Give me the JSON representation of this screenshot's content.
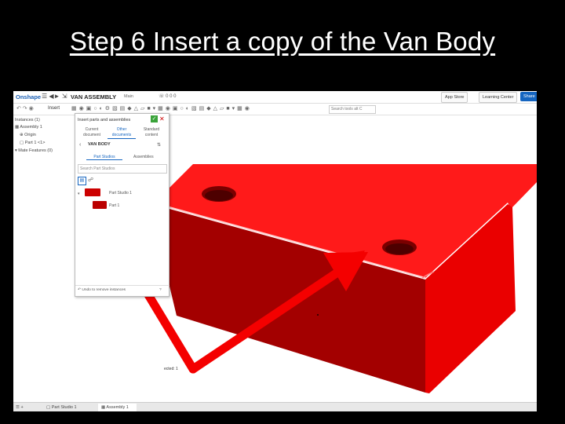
{
  "slide": {
    "title": "Step 6 Insert a copy of the Van Body"
  },
  "topbar": {
    "logo": "Onshape",
    "doc_title": "VAN ASSEMBLY",
    "doc_sub": "Main",
    "counts": "0   0   0",
    "app_store": "App Store",
    "learning_center": "Learning Center",
    "share": "Share"
  },
  "toolbar": {
    "insert": "Insert",
    "search": "Search tools",
    "search_shortcut": "alt C"
  },
  "left_panel": {
    "instances": "Instances (1)",
    "assembly": "Assembly 1",
    "origin": "Origin",
    "part": "Part 1 <1>",
    "mate_features": "Mate Features (0)"
  },
  "dialog": {
    "title": "Insert parts and assemblies",
    "seg_current": "Current document",
    "seg_other": "Other documents",
    "seg_standard": "Standard content",
    "doc_name": "VAN BODY",
    "tab_part_studios": "Part Studios",
    "tab_assemblies": "Assemblies",
    "search_placeholder": "Search Part Studios",
    "tree_part_studio": "Part Studio 1",
    "tree_part": "Part 1",
    "bottom_hint": "Undo to remove instances"
  },
  "viewport": {
    "mate_label": "ected: 1"
  },
  "tabs": {
    "part_studio": "Part Studio 1",
    "assembly": "Assembly 1"
  },
  "colors": {
    "part_top": "#ff1a1a",
    "part_front": "#a30000",
    "part_side": "#ea0000",
    "arrow": "#f40000",
    "share": "#1565c0"
  }
}
